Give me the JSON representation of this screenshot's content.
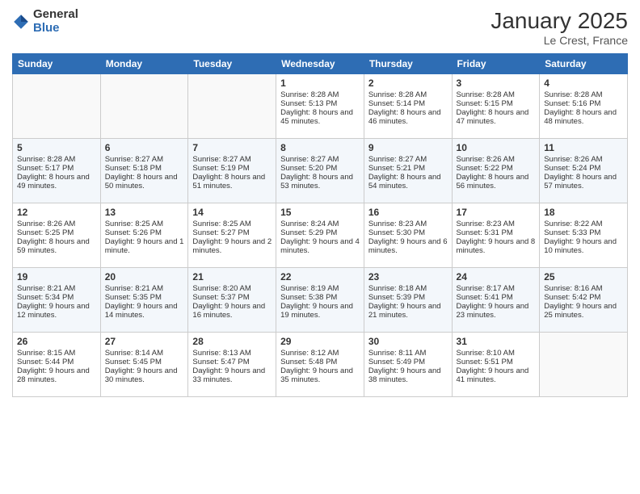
{
  "header": {
    "logo_general": "General",
    "logo_blue": "Blue",
    "month_title": "January 2025",
    "location": "Le Crest, France"
  },
  "days_of_week": [
    "Sunday",
    "Monday",
    "Tuesday",
    "Wednesday",
    "Thursday",
    "Friday",
    "Saturday"
  ],
  "weeks": [
    [
      {
        "day": "",
        "empty": true
      },
      {
        "day": "",
        "empty": true
      },
      {
        "day": "",
        "empty": true
      },
      {
        "day": "1",
        "sunrise": "8:28 AM",
        "sunset": "5:13 PM",
        "daylight": "8 hours and 45 minutes."
      },
      {
        "day": "2",
        "sunrise": "8:28 AM",
        "sunset": "5:14 PM",
        "daylight": "8 hours and 46 minutes."
      },
      {
        "day": "3",
        "sunrise": "8:28 AM",
        "sunset": "5:15 PM",
        "daylight": "8 hours and 47 minutes."
      },
      {
        "day": "4",
        "sunrise": "8:28 AM",
        "sunset": "5:16 PM",
        "daylight": "8 hours and 48 minutes."
      }
    ],
    [
      {
        "day": "5",
        "sunrise": "8:28 AM",
        "sunset": "5:17 PM",
        "daylight": "8 hours and 49 minutes."
      },
      {
        "day": "6",
        "sunrise": "8:27 AM",
        "sunset": "5:18 PM",
        "daylight": "8 hours and 50 minutes."
      },
      {
        "day": "7",
        "sunrise": "8:27 AM",
        "sunset": "5:19 PM",
        "daylight": "8 hours and 51 minutes."
      },
      {
        "day": "8",
        "sunrise": "8:27 AM",
        "sunset": "5:20 PM",
        "daylight": "8 hours and 53 minutes."
      },
      {
        "day": "9",
        "sunrise": "8:27 AM",
        "sunset": "5:21 PM",
        "daylight": "8 hours and 54 minutes."
      },
      {
        "day": "10",
        "sunrise": "8:26 AM",
        "sunset": "5:22 PM",
        "daylight": "8 hours and 56 minutes."
      },
      {
        "day": "11",
        "sunrise": "8:26 AM",
        "sunset": "5:24 PM",
        "daylight": "8 hours and 57 minutes."
      }
    ],
    [
      {
        "day": "12",
        "sunrise": "8:26 AM",
        "sunset": "5:25 PM",
        "daylight": "8 hours and 59 minutes."
      },
      {
        "day": "13",
        "sunrise": "8:25 AM",
        "sunset": "5:26 PM",
        "daylight": "9 hours and 1 minute."
      },
      {
        "day": "14",
        "sunrise": "8:25 AM",
        "sunset": "5:27 PM",
        "daylight": "9 hours and 2 minutes."
      },
      {
        "day": "15",
        "sunrise": "8:24 AM",
        "sunset": "5:29 PM",
        "daylight": "9 hours and 4 minutes."
      },
      {
        "day": "16",
        "sunrise": "8:23 AM",
        "sunset": "5:30 PM",
        "daylight": "9 hours and 6 minutes."
      },
      {
        "day": "17",
        "sunrise": "8:23 AM",
        "sunset": "5:31 PM",
        "daylight": "9 hours and 8 minutes."
      },
      {
        "day": "18",
        "sunrise": "8:22 AM",
        "sunset": "5:33 PM",
        "daylight": "9 hours and 10 minutes."
      }
    ],
    [
      {
        "day": "19",
        "sunrise": "8:21 AM",
        "sunset": "5:34 PM",
        "daylight": "9 hours and 12 minutes."
      },
      {
        "day": "20",
        "sunrise": "8:21 AM",
        "sunset": "5:35 PM",
        "daylight": "9 hours and 14 minutes."
      },
      {
        "day": "21",
        "sunrise": "8:20 AM",
        "sunset": "5:37 PM",
        "daylight": "9 hours and 16 minutes."
      },
      {
        "day": "22",
        "sunrise": "8:19 AM",
        "sunset": "5:38 PM",
        "daylight": "9 hours and 19 minutes."
      },
      {
        "day": "23",
        "sunrise": "8:18 AM",
        "sunset": "5:39 PM",
        "daylight": "9 hours and 21 minutes."
      },
      {
        "day": "24",
        "sunrise": "8:17 AM",
        "sunset": "5:41 PM",
        "daylight": "9 hours and 23 minutes."
      },
      {
        "day": "25",
        "sunrise": "8:16 AM",
        "sunset": "5:42 PM",
        "daylight": "9 hours and 25 minutes."
      }
    ],
    [
      {
        "day": "26",
        "sunrise": "8:15 AM",
        "sunset": "5:44 PM",
        "daylight": "9 hours and 28 minutes."
      },
      {
        "day": "27",
        "sunrise": "8:14 AM",
        "sunset": "5:45 PM",
        "daylight": "9 hours and 30 minutes."
      },
      {
        "day": "28",
        "sunrise": "8:13 AM",
        "sunset": "5:47 PM",
        "daylight": "9 hours and 33 minutes."
      },
      {
        "day": "29",
        "sunrise": "8:12 AM",
        "sunset": "5:48 PM",
        "daylight": "9 hours and 35 minutes."
      },
      {
        "day": "30",
        "sunrise": "8:11 AM",
        "sunset": "5:49 PM",
        "daylight": "9 hours and 38 minutes."
      },
      {
        "day": "31",
        "sunrise": "8:10 AM",
        "sunset": "5:51 PM",
        "daylight": "9 hours and 41 minutes."
      },
      {
        "day": "",
        "empty": true
      }
    ]
  ],
  "labels": {
    "sunrise": "Sunrise:",
    "sunset": "Sunset:",
    "daylight": "Daylight:"
  }
}
